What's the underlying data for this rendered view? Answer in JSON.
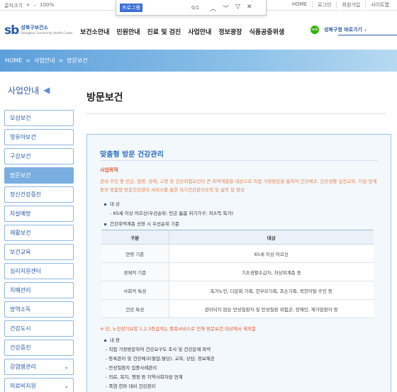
{
  "util": {
    "font_size_label": "글자크기",
    "plus": "+",
    "minus": "–",
    "zoom": "100%",
    "links": [
      "HOME",
      "로그인",
      "회원가입",
      "사이트맵"
    ]
  },
  "find": {
    "query": "프로그램",
    "count": "0/1",
    "up": "︿",
    "down": "﹀",
    "filter": "▽",
    "close": "✕"
  },
  "header": {
    "logo_mark": "sb",
    "logo_name": "성북구보건소",
    "logo_sub": "Seongbuk Community Health Center",
    "nav": [
      "보건소안내",
      "민원안내",
      "진료 및 검진",
      "사업안내",
      "정보광장",
      "식품공중위생"
    ],
    "talk_badge": "talk",
    "shortcut": "성북구청 바로가기",
    "shortcut_arrow": "›"
  },
  "breadcrumb": [
    "HOME",
    ">",
    "사업안내",
    ">",
    "방문보건"
  ],
  "sidebar": {
    "title": "사업안내",
    "arrow": "◀",
    "items": [
      {
        "label": "모성보건",
        "chev": ""
      },
      {
        "label": "영유아보건",
        "chev": ""
      },
      {
        "label": "구강보건",
        "chev": ""
      },
      {
        "label": "방문보건",
        "chev": ""
      },
      {
        "label": "정신건강증진",
        "chev": ""
      },
      {
        "label": "자살예방",
        "chev": ""
      },
      {
        "label": "재활보건",
        "chev": ""
      },
      {
        "label": "보건교육",
        "chev": ""
      },
      {
        "label": "심리지원센터",
        "chev": ""
      },
      {
        "label": "치매관리",
        "chev": ""
      },
      {
        "label": "방역소독",
        "chev": ""
      },
      {
        "label": "건강도시",
        "chev": ""
      },
      {
        "label": "건강증진",
        "chev": ""
      },
      {
        "label": "감염병관리",
        "chev": "⌄"
      },
      {
        "label": "의료비지원",
        "chev": "⌄"
      }
    ]
  },
  "page": {
    "title": "방문보건",
    "section_title": "맞춤형 방문 건강관리",
    "purpose_label": "사업목적",
    "purpose_desc": "관내 주민 중 빈곤, 질병, 장애, 고령 등 건강위험요인이 큰 취약계층을 대상으로 직접 가정방문을 통하여 건강체크, 건강생활 실천교육, 지원 연계 등의 맞춤형 방문건강관리 서비스를 통한 자기건강관리능력 및 삶의 질 향상",
    "target_label": "대 상",
    "target_desc": "- 65세 이상 어르신(우선순위: 빈곤 틈봄 위기가구, 저소득 독거)",
    "criteria_label": "건강취약계층 선정 시 우선순위 기준",
    "table": {
      "headers": [
        "구분",
        "대상"
      ],
      "rows": [
        [
          "연령 기준",
          "65세 이상 어르신"
        ],
        [
          "경제적 기준",
          "기초생활수급자, 차상위계층 등"
        ],
        [
          "사회적 특성",
          "독거노인, 다문화 가족, 한부모가족, 조손가족, 북한이탈 주민 등"
        ],
        [
          "건강 특성",
          "관리되지 않은 만성질환자 및 만성질환 위험군, 장애인, 재가암환자 등"
        ]
      ]
    },
    "note": "※ 단, 노인장기요양 1,2,3등급자는 중복서비스로 인해 방문보건 대상에서 제외함",
    "content_label": "내 용",
    "content_items": [
      "- 직접 가정방문하여 건강요구도 조사 및 건강문제 파악",
      "- 등록관리 및 건강체크(혈압,혈당), 교육, 상담, 정보제공",
      "- 만성질환자 집중사례관리",
      "- 의료, 복지, 행정 등 지역사회자원 연계",
      "- 폭염·한파 대비 건강관리"
    ]
  }
}
